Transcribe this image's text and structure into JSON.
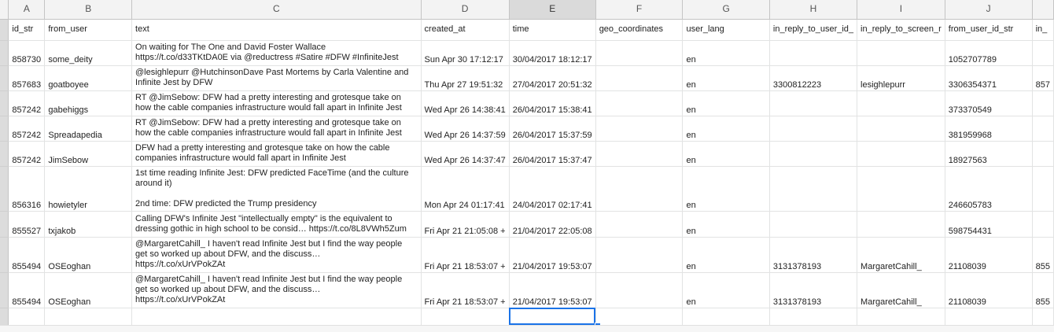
{
  "columns": [
    "A",
    "B",
    "C",
    "D",
    "E",
    "F",
    "G",
    "H",
    "I",
    "J",
    "K"
  ],
  "selected_column": "E",
  "header_row": {
    "id_str": "id_str",
    "from_user": "from_user",
    "text": "text",
    "created_at": "created_at",
    "time": "time",
    "geo_coordinates": "geo_coordinates",
    "user_lang": "user_lang",
    "in_reply_to_user_id": "in_reply_to_user_id_",
    "in_reply_to_screen_name": "in_reply_to_screen_r",
    "from_user_id_str": "from_user_id_str",
    "extra": "in_"
  },
  "rows": [
    {
      "id_str": "858730",
      "from_user": "some_deity",
      "text": "On waiting for The One and David Foster Wallace\nhttps://t.co/d33TKtDA0E via @reductress #Satire #DFW #InfiniteJest",
      "created_at": "Sun Apr 30 17:12:17",
      "time": "30/04/2017 18:12:17",
      "geo": "",
      "lang": "en",
      "reply_id": "",
      "reply_name": "",
      "user_id": "1052707789",
      "extra": ""
    },
    {
      "id_str": "857683",
      "from_user": "goatboyee",
      "text": "@lesighlepurr @HutchinsonDave Past Mortems by Carla Valentine and\nInfinite Jest by DFW",
      "created_at": "Thu Apr 27 19:51:32",
      "time": "27/04/2017 20:51:32",
      "geo": "",
      "lang": "en",
      "reply_id": "3300812223",
      "reply_name": "lesighlepurr",
      "user_id": "3306354371",
      "extra": "857"
    },
    {
      "id_str": "857242",
      "from_user": "gabehiggs",
      "text": "RT @JimSebow: DFW had a pretty interesting and grotesque take on\nhow the cable companies infrastructure would fall apart in Infinite Jest",
      "created_at": "Wed Apr 26 14:38:41",
      "time": "26/04/2017 15:38:41",
      "geo": "",
      "lang": "en",
      "reply_id": "",
      "reply_name": "",
      "user_id": "373370549",
      "extra": ""
    },
    {
      "id_str": "857242",
      "from_user": "Spreadapedia",
      "text": "RT @JimSebow: DFW had a pretty interesting and grotesque take on\nhow the cable companies infrastructure would fall apart in Infinite Jest",
      "created_at": "Wed Apr 26 14:37:59",
      "time": "26/04/2017 15:37:59",
      "geo": "",
      "lang": "en",
      "reply_id": "",
      "reply_name": "",
      "user_id": "381959968",
      "extra": ""
    },
    {
      "id_str": "857242",
      "from_user": "JimSebow",
      "text": "DFW had a pretty interesting and grotesque take on how the cable\ncompanies infrastructure would fall apart in Infinite Jest",
      "created_at": "Wed Apr 26 14:37:47",
      "time": "26/04/2017 15:37:47",
      "geo": "",
      "lang": "en",
      "reply_id": "",
      "reply_name": "",
      "user_id": "18927563",
      "extra": ""
    },
    {
      "id_str": "856316",
      "from_user": "howietyler",
      "text": "1st time reading Infinite Jest: DFW predicted FaceTime (and the culture\naround it)\n\n2nd time: DFW predicted the Trump presidency",
      "created_at": "Mon Apr 24 01:17:41",
      "time": "24/04/2017 02:17:41",
      "geo": "",
      "lang": "en",
      "reply_id": "",
      "reply_name": "",
      "user_id": "246605783",
      "extra": ""
    },
    {
      "id_str": "855527",
      "from_user": "txjakob",
      "text": "Calling DFW's Infinite Jest \"intellectually empty\" is the equivalent to\ndressing gothic in high school to be consid… https://t.co/8L8VWh5Zum",
      "created_at": "Fri Apr 21 21:05:08 +",
      "time": "21/04/2017 22:05:08",
      "geo": "",
      "lang": "en",
      "reply_id": "",
      "reply_name": "",
      "user_id": "598754431",
      "extra": ""
    },
    {
      "id_str": "855494",
      "from_user": "OSEoghan",
      "text": "@MargaretCahill_ I haven't read Infinite Jest but I find the way people\nget so worked up about DFW, and the discuss…\nhttps://t.co/xUrVPokZAt",
      "created_at": "Fri Apr 21 18:53:07 +",
      "time": "21/04/2017 19:53:07",
      "geo": "",
      "lang": "en",
      "reply_id": "3131378193",
      "reply_name": "MargaretCahill_",
      "user_id": "21108039",
      "extra": "855"
    },
    {
      "id_str": "855494",
      "from_user": "OSEoghan",
      "text": "@MargaretCahill_ I haven't read Infinite Jest but I find the way people\nget so worked up about DFW, and the discuss…\nhttps://t.co/xUrVPokZAt",
      "created_at": "Fri Apr 21 18:53:07 +",
      "time": "21/04/2017 19:53:07",
      "geo": "",
      "lang": "en",
      "reply_id": "3131378193",
      "reply_name": "MargaretCahill_",
      "user_id": "21108039",
      "extra": "855"
    }
  ],
  "colors": {
    "selection": "#1a73e8",
    "header_bg": "#f3f3f3",
    "gridline": "#e2e3e3"
  }
}
